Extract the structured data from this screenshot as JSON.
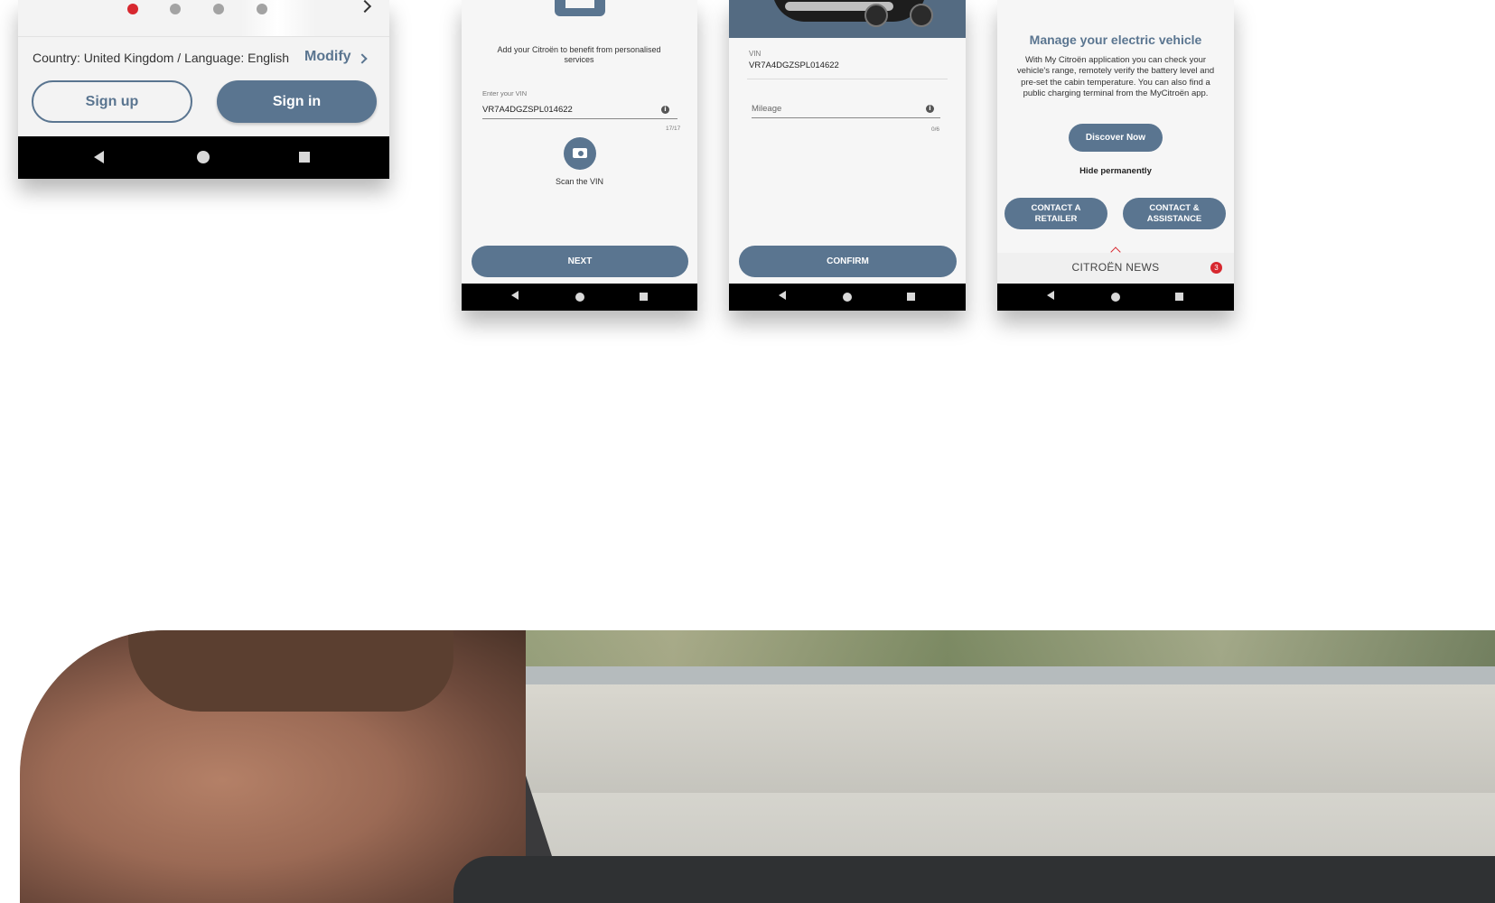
{
  "phone1": {
    "dots": [
      true,
      false,
      false,
      false
    ],
    "country_line": "Country: United Kingdom / Language: English",
    "modify_label": "Modify",
    "signup_label": "Sign up",
    "signin_label": "Sign in"
  },
  "phone2": {
    "intro": "Add your Citroën to benefit from personalised services",
    "vin_label": "Enter your VIN",
    "vin_value": "VR7A4DGZSPL014622",
    "vin_counter": "17/17",
    "scan_label": "Scan the VIN",
    "next_label": "NEXT"
  },
  "phone3": {
    "vin_label": "VIN",
    "vin_value": "VR7A4DGZSPL014622",
    "mileage_placeholder": "Mileage",
    "mileage_counter": "0/6",
    "confirm_label": "CONFIRM"
  },
  "phone4": {
    "title": "Manage your electric vehicle",
    "body": "With My Citroën application you can check your vehicle's range, remotely verify the battery level and pre-set the cabin temperature. You can also find a public charging terminal from the MyCitroën app.",
    "discover_label": "Discover Now",
    "hide_label": "Hide permanently",
    "contact_retailer_label": "CONTACT A RETAILER",
    "contact_assistance_label": "CONTACT & ASSISTANCE",
    "news_label": "CITROËN NEWS",
    "news_count": "3"
  },
  "colors": {
    "accent": "#5a7590",
    "active_dot": "#d7282f"
  }
}
